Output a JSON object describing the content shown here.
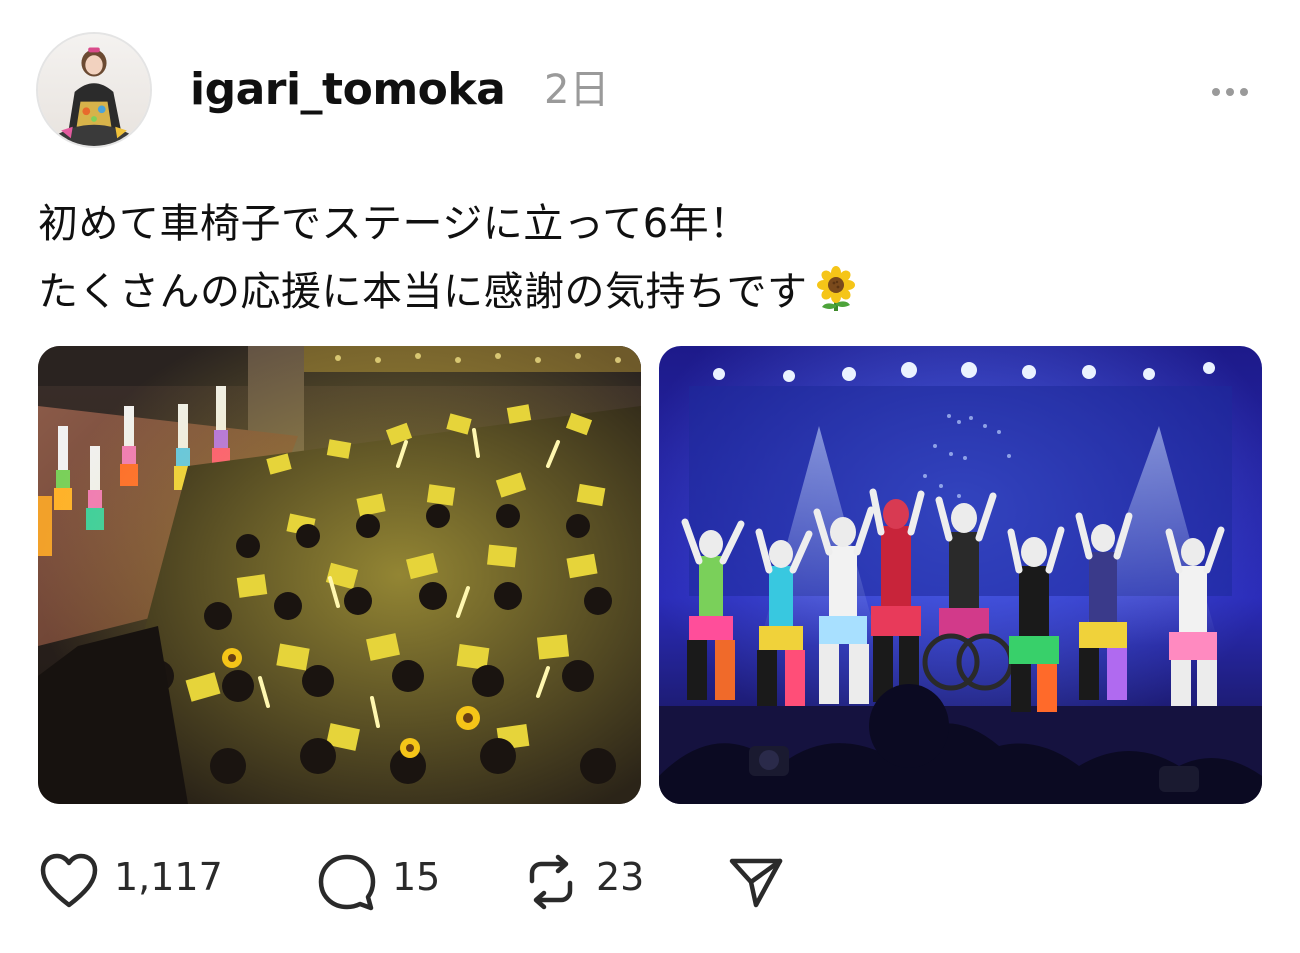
{
  "post": {
    "author": {
      "username": "igari_tomoka",
      "avatar_icon": "profile-photo"
    },
    "timestamp": "2日",
    "caption": {
      "line1": "初めて車椅子でステージに立って6年！",
      "line2": "たくさんの応援に本当に感謝の気持ちです",
      "emoji": "sunflower-emoji"
    },
    "images": [
      {
        "description_icon": "concert-audience-photo"
      },
      {
        "description_icon": "stage-performance-photo"
      }
    ],
    "actions": {
      "like": {
        "icon": "heart-icon",
        "count": "1,117"
      },
      "comment": {
        "icon": "comment-bubble-icon",
        "count": "15"
      },
      "repost": {
        "icon": "repost-icon",
        "count": "23"
      },
      "share": {
        "icon": "send-icon"
      }
    },
    "menu": {
      "icon": "more-options-icon"
    }
  },
  "colors": {
    "text": "#101010",
    "muted": "#9a9a9a",
    "icon": "#2a2a2a"
  }
}
